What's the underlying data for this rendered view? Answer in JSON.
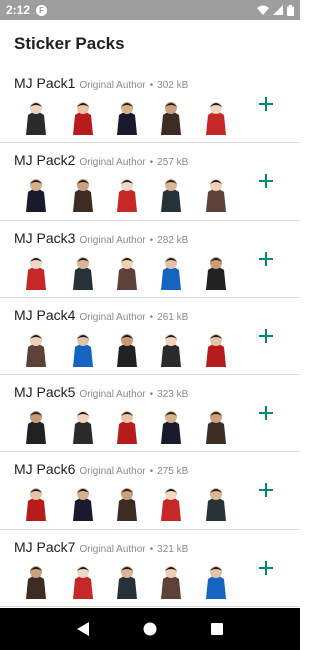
{
  "status_bar": {
    "time": "2:12",
    "app_glyph": "F",
    "icons": [
      "wifi-icon",
      "signal-icon",
      "battery-icon"
    ],
    "background": "#9e9e9e"
  },
  "app": {
    "title": "Sticker Packs",
    "accent_color": "#00897b"
  },
  "packs": [
    {
      "name": "MJ Pack1",
      "author": "Original Author",
      "separator": "•",
      "size": "302 kB",
      "sticker_count": 5
    },
    {
      "name": "MJ Pack2",
      "author": "Original Author",
      "separator": "•",
      "size": "257 kB",
      "sticker_count": 5
    },
    {
      "name": "MJ Pack3",
      "author": "Original Author",
      "separator": "•",
      "size": "282 kB",
      "sticker_count": 5
    },
    {
      "name": "MJ Pack4",
      "author": "Original Author",
      "separator": "•",
      "size": "261 kB",
      "sticker_count": 5
    },
    {
      "name": "MJ Pack5",
      "author": "Original Author",
      "separator": "•",
      "size": "323 kB",
      "sticker_count": 5
    },
    {
      "name": "MJ Pack6",
      "author": "Original Author",
      "separator": "•",
      "size": "275 kB",
      "sticker_count": 5
    },
    {
      "name": "MJ Pack7",
      "author": "Original Author",
      "separator": "•",
      "size": "321 kB",
      "sticker_count": 5
    }
  ],
  "nav_bar": {
    "buttons": [
      "back-icon",
      "home-icon",
      "recents-icon"
    ]
  }
}
